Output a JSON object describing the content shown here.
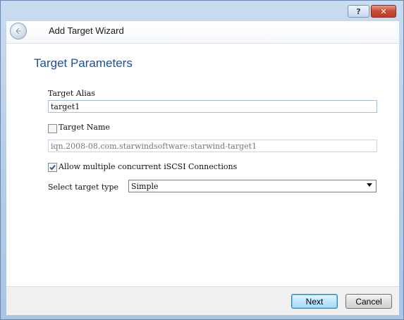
{
  "window": {
    "help_label": "?",
    "close_label": "✕"
  },
  "header": {
    "title": "Add Target Wizard",
    "back_icon": "back-arrow-icon"
  },
  "page": {
    "title": "Target Parameters"
  },
  "form": {
    "alias_label": "Target Alias",
    "alias_value": "target1",
    "name_checkbox_label": "Target Name",
    "name_checked": false,
    "name_value": "iqn.2008-08.com.starwindsoftware:starwind-target1",
    "concurrent_label": "Allow multiple concurrent iSCSI Connections",
    "concurrent_checked": true,
    "type_label": "Select target type",
    "type_value": "Simple"
  },
  "footer": {
    "next_label": "Next",
    "cancel_label": "Cancel"
  },
  "colors": {
    "accent_title": "#1e4f91",
    "close_button": "#c74a36",
    "default_button_border": "#3c7fb1"
  }
}
